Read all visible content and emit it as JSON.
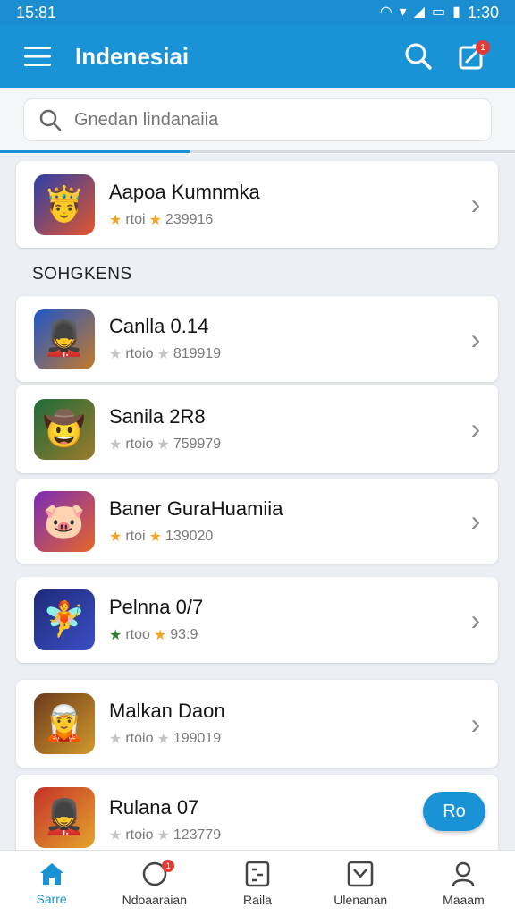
{
  "status_bar": {
    "time_left": "15:81",
    "time_right": "1:30"
  },
  "app_bar": {
    "title": "Indenesiai",
    "notification_count": "1"
  },
  "search": {
    "placeholder": "Gnedan lindanaiia",
    "progress": 0.37
  },
  "featured": {
    "title": "Aapoa Kumnmka",
    "meta_text": "rtoi",
    "count": "239916",
    "icon": "hero-crown-icon",
    "stars": "gold"
  },
  "section_title": "SOHGKENS",
  "items": [
    {
      "title": "Canlla 0.14",
      "meta_text": "rtoio",
      "count": "819919",
      "icon": "soldier-icon",
      "stars": "gray"
    },
    {
      "title": "Sanila 2R8",
      "meta_text": "rtoio",
      "count": "759979",
      "icon": "explorer-icon",
      "stars": "gray"
    },
    {
      "title": "Baner GuraHuamiia",
      "meta_text": "rtoi",
      "count": "139020",
      "icon": "creature-icon",
      "stars": "gold"
    },
    {
      "title": "Pelnna 0/7",
      "meta_text": "rtoo",
      "count": "93:9",
      "icon": "star-hero-icon",
      "stars": "gold"
    },
    {
      "title": "Malkan Daon",
      "meta_text": "rtoio",
      "count": "199019",
      "icon": "warrior-icon",
      "stars": "gray"
    },
    {
      "title": "Rulana 07",
      "meta_text": "rtoio",
      "count": "123779",
      "icon": "guard-icon",
      "stars": "gray"
    }
  ],
  "fab_label": "Ro",
  "bottom_nav": [
    {
      "label": "Sarre",
      "icon": "home-icon",
      "active": true
    },
    {
      "label": "Ndoaaraian",
      "icon": "notification-icon",
      "active": false,
      "badge": "1"
    },
    {
      "label": "Raila",
      "icon": "list-icon",
      "active": false
    },
    {
      "label": "Ulenanan",
      "icon": "inbox-icon",
      "active": false
    },
    {
      "label": "Maaam",
      "icon": "profile-icon",
      "active": false
    }
  ],
  "colors": {
    "primary": "#1a93d6",
    "star_gold": "#f2a428",
    "star_gray": "#c4c4c4",
    "badge": "#e53935"
  }
}
